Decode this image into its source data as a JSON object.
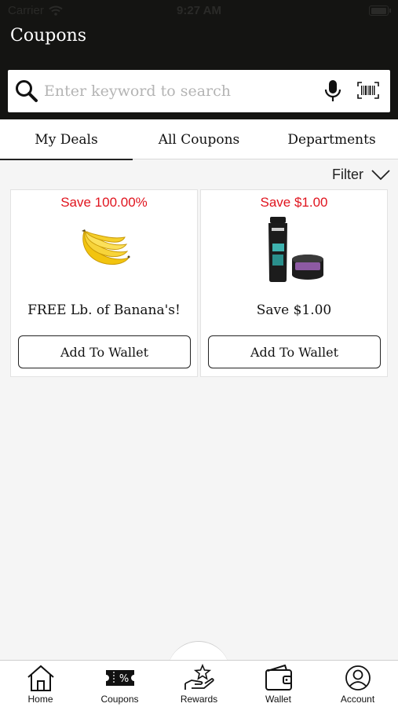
{
  "status_bar": {
    "carrier": "Carrier",
    "time": "9:27 AM",
    "battery_level": 1.0
  },
  "header": {
    "title": "Coupons"
  },
  "search": {
    "placeholder": "Enter keyword to search",
    "value": "",
    "icons": [
      "search-icon",
      "microphone-icon",
      "barcode-icon"
    ]
  },
  "tabs": [
    {
      "label": "My Deals",
      "active": true
    },
    {
      "label": "All Coupons",
      "active": false
    },
    {
      "label": "Departments",
      "active": false
    }
  ],
  "filter": {
    "label": "Filter",
    "icon": "chevron-down-icon"
  },
  "coupons": [
    {
      "save": "Save 100.00%",
      "title": "FREE Lb. of Banana's!",
      "button": "Add To Wallet",
      "image": "bananas"
    },
    {
      "save": "Save $1.00",
      "title": "Save $1.00",
      "button": "Add To Wallet",
      "image": "axe-body-wash-and-styling-product"
    }
  ],
  "bottom_nav": [
    {
      "label": "Home",
      "icon": "home-icon"
    },
    {
      "label": "Coupons",
      "icon": "coupon-ticket-icon",
      "icon_text": "%"
    },
    {
      "label": "Rewards",
      "icon": "rewards-star-hand-icon"
    },
    {
      "label": "Wallet",
      "icon": "wallet-icon"
    },
    {
      "label": "Account",
      "icon": "account-icon"
    }
  ],
  "colors": {
    "header_bg": "#141412",
    "save_red": "#e0141e",
    "page_bg": "#f5f5f5"
  }
}
